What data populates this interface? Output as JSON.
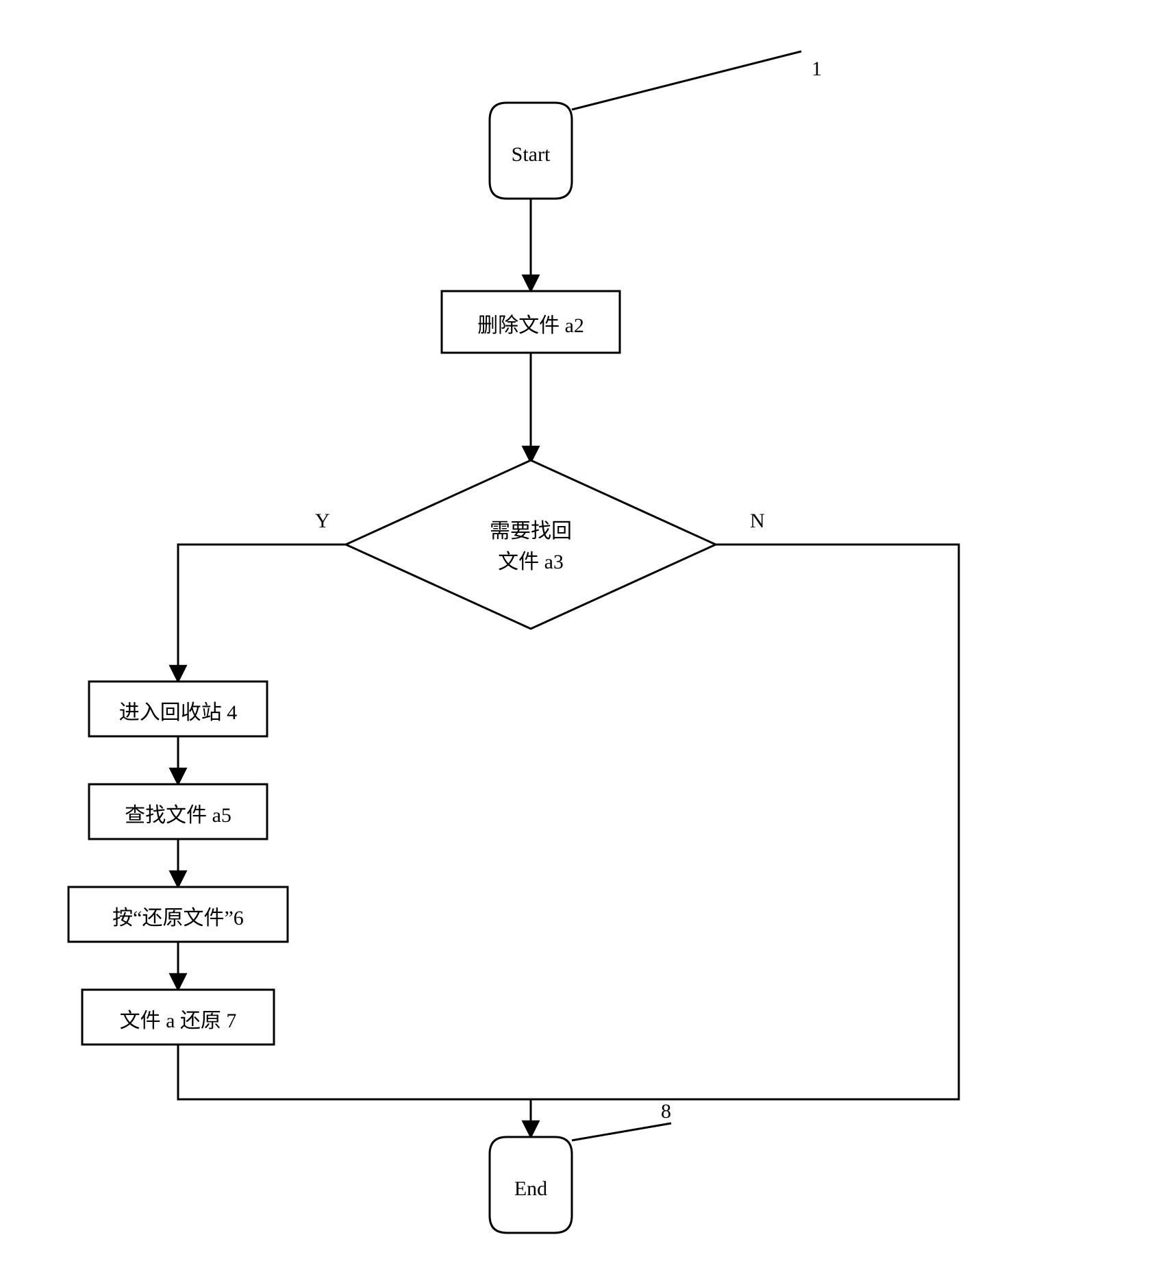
{
  "flow": {
    "start": "Start",
    "end": "End",
    "step_delete": "删除文件 a2",
    "decision_line1": "需要找回",
    "decision_line2": "文件 a3",
    "step_recycle": "进入回收站 4",
    "step_find": "查找文件 a5",
    "step_restore_btn": "按“还原文件”6",
    "step_restored": "文件 a 还原 7",
    "yes": "Y",
    "no": "N",
    "ref_start": "1",
    "ref_end": "8"
  },
  "chart_data": {
    "type": "flowchart",
    "nodes": [
      {
        "id": "1",
        "type": "terminator",
        "label": "Start"
      },
      {
        "id": "2",
        "type": "process",
        "label": "删除文件 a2"
      },
      {
        "id": "3",
        "type": "decision",
        "label": "需要找回 文件 a3"
      },
      {
        "id": "4",
        "type": "process",
        "label": "进入回收站 4"
      },
      {
        "id": "5",
        "type": "process",
        "label": "查找文件 a5"
      },
      {
        "id": "6",
        "type": "process",
        "label": "按“还原文件”6"
      },
      {
        "id": "7",
        "type": "process",
        "label": "文件 a 还原 7"
      },
      {
        "id": "8",
        "type": "terminator",
        "label": "End"
      }
    ],
    "edges": [
      {
        "from": "1",
        "to": "2"
      },
      {
        "from": "2",
        "to": "3"
      },
      {
        "from": "3",
        "to": "4",
        "label": "Y"
      },
      {
        "from": "4",
        "to": "5"
      },
      {
        "from": "5",
        "to": "6"
      },
      {
        "from": "6",
        "to": "7"
      },
      {
        "from": "7",
        "to": "8"
      },
      {
        "from": "3",
        "to": "8",
        "label": "N"
      }
    ]
  }
}
